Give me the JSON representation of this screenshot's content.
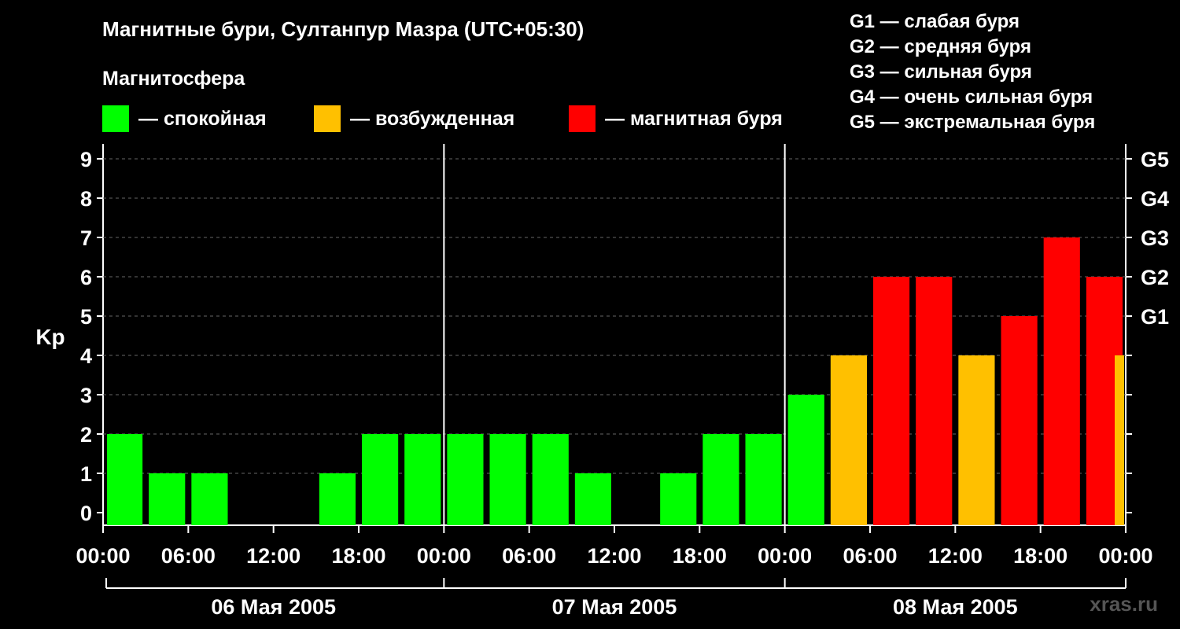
{
  "header": {
    "title": "Магнитные бури, Султанпур Мазра (UTC+05:30)",
    "section_label": "Магнитосфера"
  },
  "legend": [
    {
      "label": "— спокойная",
      "color": "#00ff00"
    },
    {
      "label": "— возбужденная",
      "color": "#ffc000"
    },
    {
      "label": "— магнитная буря",
      "color": "#ff0000"
    }
  ],
  "g_scale": [
    "G1 — слабая буря",
    "G2 — средняя буря",
    "G3 — сильная буря",
    "G4 — очень сильная буря",
    "G5 — экстремальная буря"
  ],
  "watermark": "xras.ru",
  "chart_data": {
    "type": "bar",
    "ylabel": "Kp",
    "ylim": [
      0,
      9
    ],
    "y_ticks": [
      "0",
      "1",
      "2",
      "3",
      "4",
      "5",
      "6",
      "7",
      "8",
      "9"
    ],
    "right_ticks": [
      {
        "kp": 5,
        "label": "G1"
      },
      {
        "kp": 6,
        "label": "G2"
      },
      {
        "kp": 7,
        "label": "G3"
      },
      {
        "kp": 8,
        "label": "G4"
      },
      {
        "kp": 9,
        "label": "G5"
      }
    ],
    "x_tick_labels": [
      "00:00",
      "06:00",
      "12:00",
      "18:00",
      "00:00",
      "06:00",
      "12:00",
      "18:00",
      "00:00",
      "06:00",
      "12:00",
      "18:00",
      "00:00"
    ],
    "days": [
      "06 Мая 2005",
      "07 Мая 2005",
      "08 Мая 2005"
    ],
    "grid": "dashed horizontal",
    "colors": {
      "quiet": "#00ff00",
      "active": "#ffc000",
      "storm": "#ff0000"
    },
    "values": [
      2,
      1,
      1,
      0,
      0,
      1,
      2,
      2,
      2,
      2,
      2,
      1,
      0,
      1,
      2,
      2,
      3,
      4,
      6,
      6,
      4,
      5,
      7,
      6,
      4
    ]
  }
}
